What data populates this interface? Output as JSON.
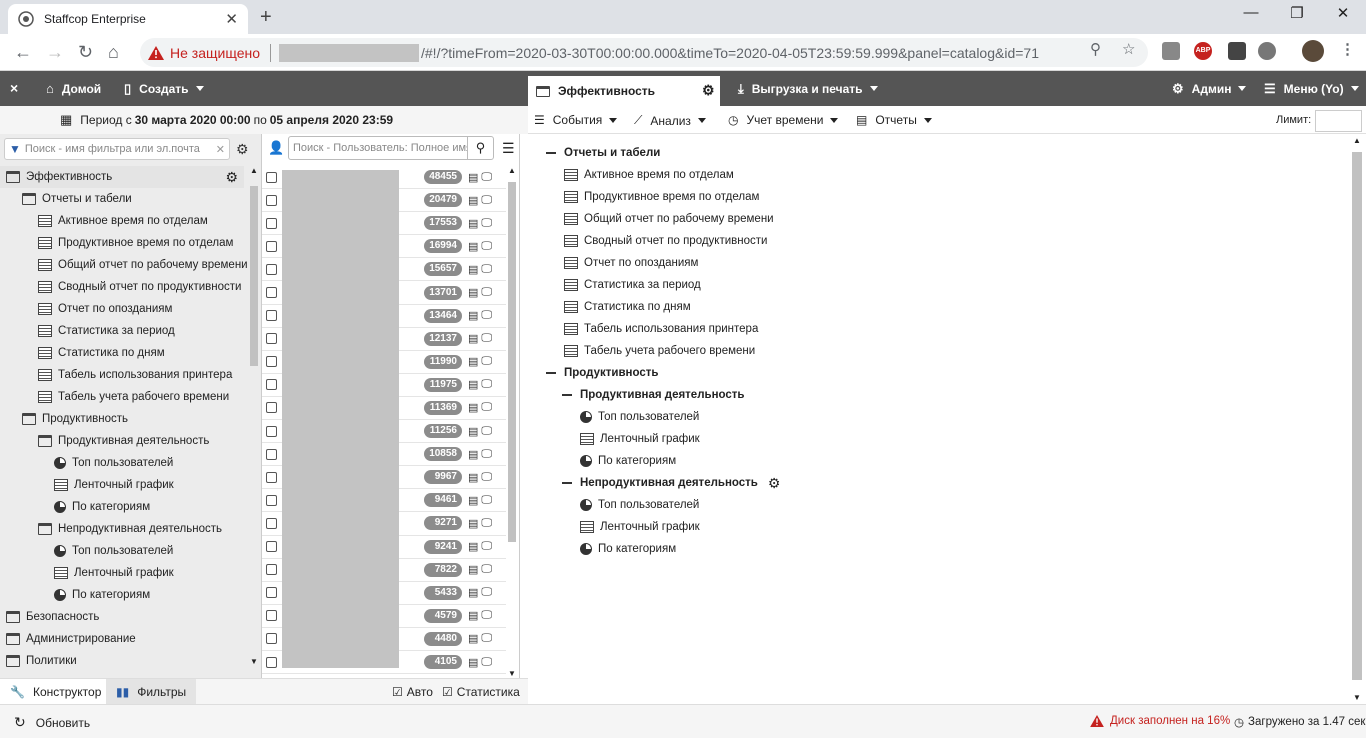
{
  "browser": {
    "tab_title": "Staffcop Enterprise",
    "close_tab": "✕",
    "new_tab": "+",
    "not_secure": "Не защищено",
    "url": "/#!/?timeFrom=2020-03-30T00:00:00.000&timeTo=2020-04-05T23:59:59.999&panel=catalog&id=71"
  },
  "app": {
    "close": "×",
    "home": "Домой",
    "create": "Создать",
    "effectiveness_tab": "Эффективность",
    "export": "Выгрузка и печать",
    "admin": "Админ",
    "menu": "Меню (Yo)",
    "period_prefix": "Период с",
    "period_from": "30 марта 2020 00:00",
    "period_mid": "по",
    "period_to": "05 апреля 2020 23:59"
  },
  "filters": {
    "search_placeholder": "Поиск - имя фильтра или эл.почта",
    "tree": [
      {
        "label": "Эффективность",
        "icon": "folder",
        "level": 0,
        "selected": true
      },
      {
        "label": "Отчеты и табели",
        "icon": "folder",
        "level": 1
      },
      {
        "label": "Активное время по отделам",
        "icon": "doc",
        "level": 2
      },
      {
        "label": "Продуктивное время по отделам",
        "icon": "doc",
        "level": 2
      },
      {
        "label": "Общий отчет по рабочему времени",
        "icon": "doc",
        "level": 2
      },
      {
        "label": "Сводный отчет по продуктивности",
        "icon": "doc",
        "level": 2
      },
      {
        "label": "Отчет по опозданиям",
        "icon": "doc",
        "level": 2
      },
      {
        "label": "Статистика за период",
        "icon": "doc",
        "level": 2
      },
      {
        "label": "Статистика по дням",
        "icon": "doc",
        "level": 2
      },
      {
        "label": "Табель использования принтера",
        "icon": "doc",
        "level": 2
      },
      {
        "label": "Табель учета рабочего времени",
        "icon": "doc",
        "level": 2
      },
      {
        "label": "Продуктивность",
        "icon": "folder",
        "level": 1
      },
      {
        "label": "Продуктивная деятельность",
        "icon": "folder",
        "level": 2
      },
      {
        "label": "Топ пользователей",
        "icon": "pie",
        "level": 3
      },
      {
        "label": "Ленточный график",
        "icon": "doc",
        "level": 3
      },
      {
        "label": "По категориям",
        "icon": "pie",
        "level": 3
      },
      {
        "label": "Непродуктивная деятельность",
        "icon": "folder",
        "level": 2
      },
      {
        "label": "Топ пользователей",
        "icon": "pie",
        "level": 3
      },
      {
        "label": "Ленточный график",
        "icon": "doc",
        "level": 3
      },
      {
        "label": "По категориям",
        "icon": "pie",
        "level": 3
      },
      {
        "label": "Безопасность",
        "icon": "folder",
        "level": 0
      },
      {
        "label": "Администрирование",
        "icon": "folder",
        "level": 0
      },
      {
        "label": "Политики",
        "icon": "folder",
        "level": 0
      }
    ],
    "constructor": "Конструктор",
    "filters_tab": "Фильтры",
    "auto": "Авто",
    "statistics": "Статистика"
  },
  "users": {
    "search_placeholder": "Поиск - Пользователь: Полное имя",
    "counts": [
      "48455",
      "20479",
      "17553",
      "16994",
      "15657",
      "13701",
      "13464",
      "12137",
      "11990",
      "11975",
      "11369",
      "11256",
      "10858",
      "9967",
      "9461",
      "9271",
      "9241",
      "7822",
      "5433",
      "4579",
      "4480",
      "4105"
    ]
  },
  "content": {
    "menus": [
      "События",
      "Анализ",
      "Учет времени",
      "Отчеты"
    ],
    "limit_label": "Лимит:",
    "limit_value": "",
    "tree": [
      {
        "label": "Отчеты и табели",
        "type": "group",
        "level": 0
      },
      {
        "label": "Активное время по отделам",
        "icon": "doc",
        "level": 1
      },
      {
        "label": "Продуктивное время по отделам",
        "icon": "doc",
        "level": 1
      },
      {
        "label": "Общий отчет по рабочему времени",
        "icon": "doc",
        "level": 1
      },
      {
        "label": "Сводный отчет по продуктивности",
        "icon": "doc",
        "level": 1
      },
      {
        "label": "Отчет по опозданиям",
        "icon": "doc",
        "level": 1
      },
      {
        "label": "Статистика за период",
        "icon": "doc",
        "level": 1
      },
      {
        "label": "Статистика по дням",
        "icon": "doc",
        "level": 1
      },
      {
        "label": "Табель использования принтера",
        "icon": "doc",
        "level": 1
      },
      {
        "label": "Табель учета рабочего времени",
        "icon": "doc",
        "level": 1
      },
      {
        "label": "Продуктивность",
        "type": "group",
        "level": 0
      },
      {
        "label": "Продуктивная деятельность",
        "type": "group",
        "level": 1
      },
      {
        "label": "Топ пользователей",
        "icon": "pie",
        "level": 2
      },
      {
        "label": "Ленточный график",
        "icon": "doc",
        "level": 2
      },
      {
        "label": "По категориям",
        "icon": "pie",
        "level": 2
      },
      {
        "label": "Непродуктивная деятельность",
        "type": "group",
        "level": 1,
        "gear": true
      },
      {
        "label": "Топ пользователей",
        "icon": "pie",
        "level": 2
      },
      {
        "label": "Ленточный график",
        "icon": "doc",
        "level": 2
      },
      {
        "label": "По категориям",
        "icon": "pie",
        "level": 2
      }
    ]
  },
  "status": {
    "refresh": "Обновить",
    "disk": "Диск заполнен на 16%",
    "loaded": "Загружено за 1.47 сек"
  },
  "colors": {
    "appbar": "#555555",
    "warning_red": "#c5221f",
    "badge_gray": "#8c8c8c"
  }
}
